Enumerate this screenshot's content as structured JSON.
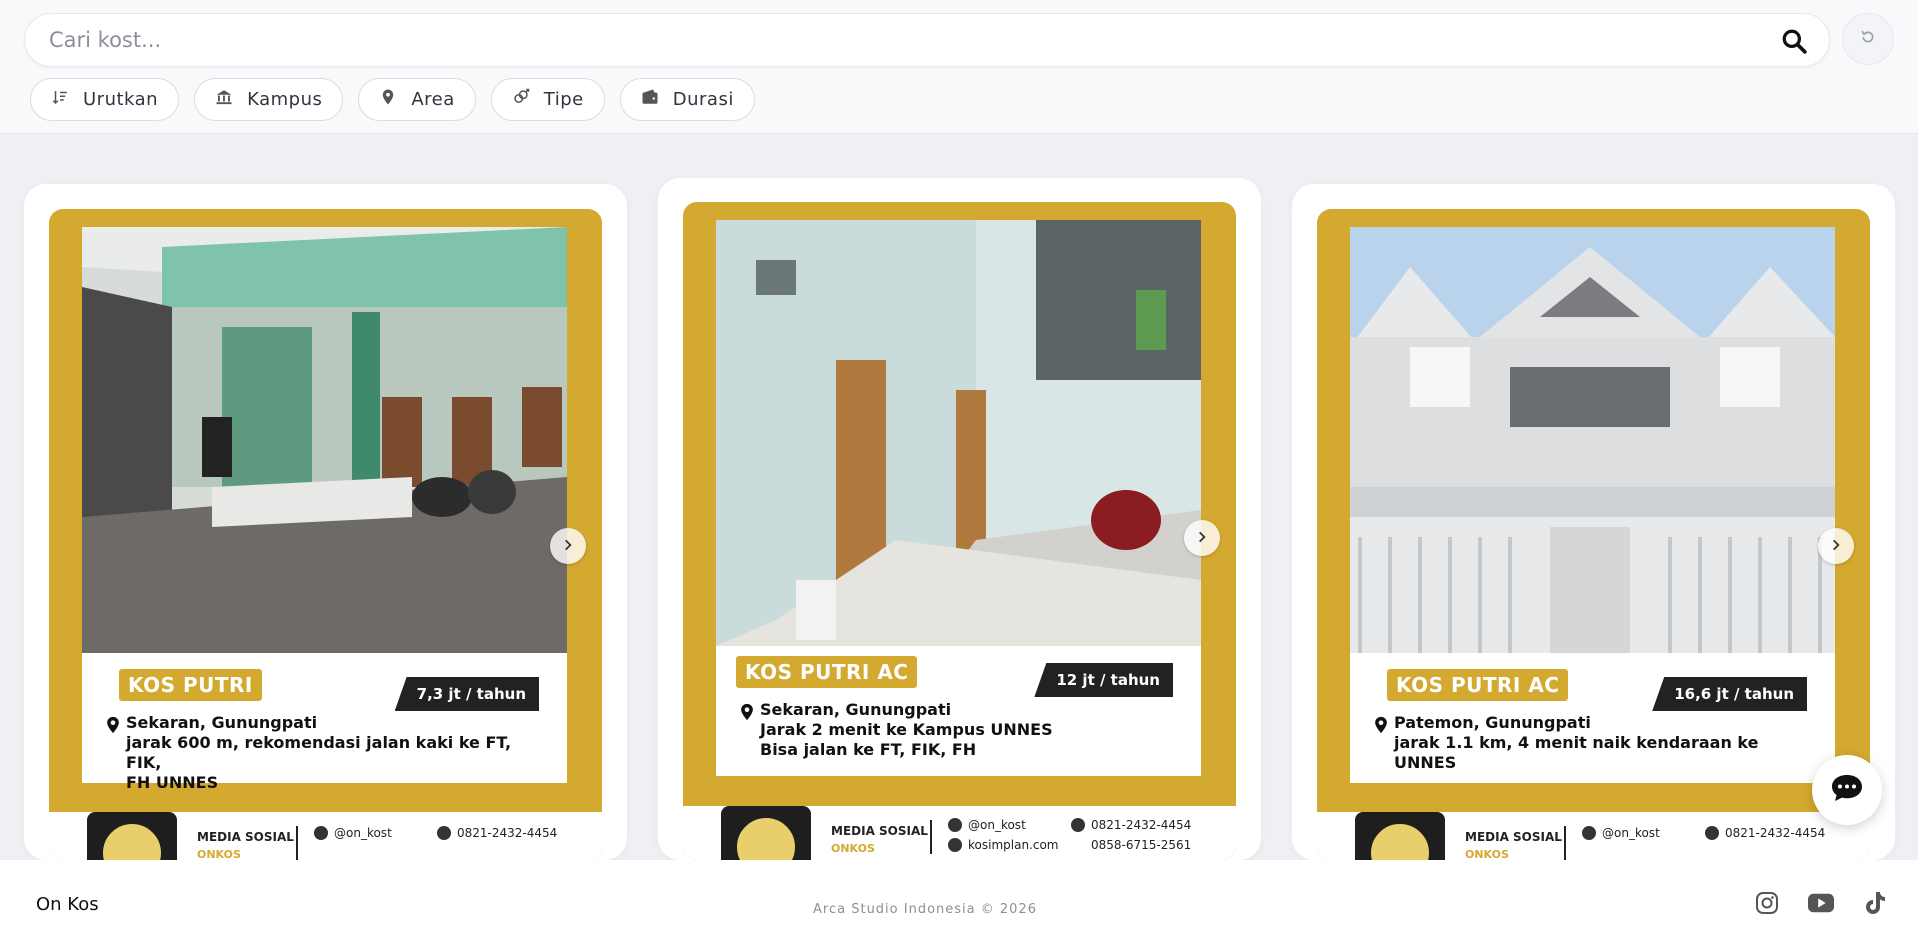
{
  "search": {
    "placeholder": "Cari kost..."
  },
  "filters": [
    {
      "label": "Urutkan",
      "icon": "sort-icon"
    },
    {
      "label": "Kampus",
      "icon": "campus-icon"
    },
    {
      "label": "Area",
      "icon": "location-pin-icon"
    },
    {
      "label": "Tipe",
      "icon": "gender-icon"
    },
    {
      "label": "Durasi",
      "icon": "wallet-icon"
    }
  ],
  "listings": [
    {
      "type": "KOS PUTRI",
      "price": "7,3 jt / tahun",
      "area": "Sekaran, Gunungpati",
      "desc1": "jarak 600 m, rekomendasi jalan kaki ke FT, FIK,",
      "desc2": "FH UNNES"
    },
    {
      "type": "KOS PUTRI AC",
      "price": "12 jt / tahun",
      "area": "Sekaran, Gunungpati",
      "desc1": "Jarak 2 menit ke Kampus UNNES",
      "desc2": "Bisa jalan ke FT, FIK, FH"
    },
    {
      "type": "KOS PUTRI AC",
      "price": "16,6 jt / tahun",
      "area": "Patemon, Gunungpati",
      "desc1": "jarak 1.1 km, 4 menit naik kendaraan ke UNNES",
      "desc2": ""
    }
  ],
  "poster_footer": {
    "title": "MEDIA SOSIAL",
    "brand": "ONKOS",
    "instagram": "@on_kost",
    "website": "kosimplan.com",
    "phone1": "0821-2432-4454",
    "phone2": "0858-6715-2561"
  },
  "footer": {
    "brand": "On Kos",
    "copyright": "Arca Studio Indonesia © 2026"
  },
  "colors": {
    "accent": "#d4a92f",
    "dark": "#222222"
  }
}
